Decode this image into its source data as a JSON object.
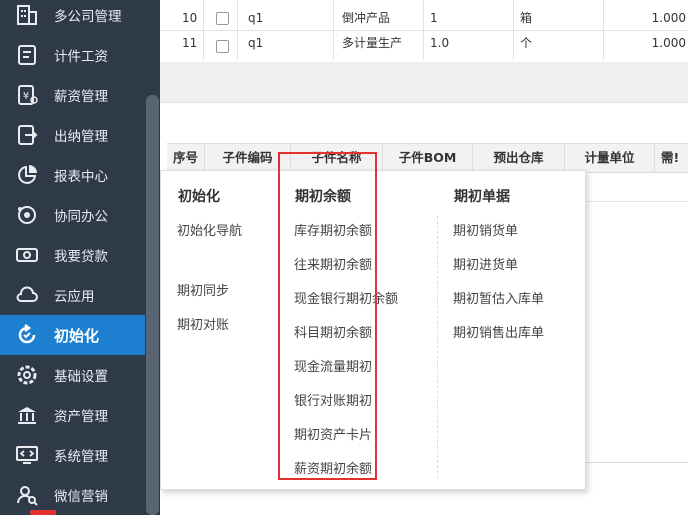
{
  "sidebar": {
    "items": [
      {
        "label": "多公司管理",
        "icon": "building-icon"
      },
      {
        "label": "计件工资",
        "icon": "form-icon"
      },
      {
        "label": "薪资管理",
        "icon": "money-doc-icon"
      },
      {
        "label": "出纳管理",
        "icon": "cashier-icon"
      },
      {
        "label": "报表中心",
        "icon": "pie-chart-icon"
      },
      {
        "label": "协同办公",
        "icon": "collaboration-icon"
      },
      {
        "label": "我要贷款",
        "icon": "cash-icon"
      },
      {
        "label": "云应用",
        "icon": "cloud-icon"
      },
      {
        "label": "初始化",
        "icon": "refresh-icon",
        "active": true
      },
      {
        "label": "基础设置",
        "icon": "settings-icon"
      },
      {
        "label": "资产管理",
        "icon": "bank-icon"
      },
      {
        "label": "系统管理",
        "icon": "code-monitor-icon"
      },
      {
        "label": "微信营销",
        "icon": "search-user-icon"
      }
    ]
  },
  "top_table": {
    "rows": [
      {
        "no": "10",
        "code": "q1",
        "name": "倒冲产品",
        "bom": "1",
        "unit": "箱",
        "qty": "1.000"
      },
      {
        "no": "11",
        "code": "q1",
        "name": "多计量生产",
        "bom": "1.0",
        "unit": "个",
        "qty": "1.000"
      }
    ]
  },
  "lower_table": {
    "headers": [
      "序号",
      "子件编码",
      "子件名称",
      "子件BOM",
      "预出仓库",
      "计量单位",
      "需!"
    ]
  },
  "menu": {
    "col1": {
      "title": "初始化",
      "items": [
        "初始化导航",
        "期初同步",
        "期初对账"
      ]
    },
    "col2": {
      "title": "期初余额",
      "items": [
        "库存期初余额",
        "往来期初余额",
        "现金银行期初余额",
        "科目期初余额",
        "现金流量期初",
        "银行对账期初",
        "期初资产卡片",
        "薪资期初余额"
      ]
    },
    "col3": {
      "title": "期初单据",
      "items": [
        "期初销货单",
        "期初进货单",
        "期初暂估入库单",
        "期初销售出库单"
      ]
    }
  },
  "colors": {
    "sidebar_bg": "#2f3a48",
    "active": "#1e7fd0",
    "highlight": "#e53030"
  }
}
